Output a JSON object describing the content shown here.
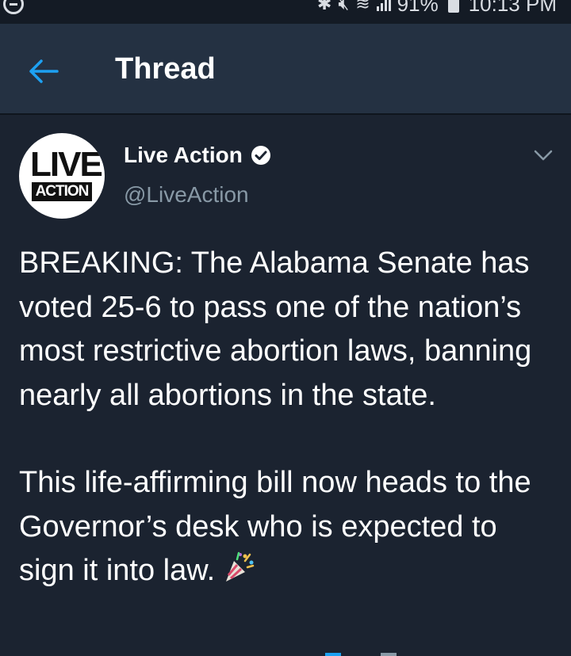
{
  "status_bar": {
    "battery": "91%",
    "time": "10:13 PM",
    "icons": [
      "minus-circle-icon",
      "bluetooth-icon",
      "mute-icon",
      "wifi-icon",
      "signal-icon",
      "battery-icon"
    ]
  },
  "header": {
    "title": "Thread",
    "back_icon": "back-arrow-icon",
    "accent_color": "#1da1f2"
  },
  "tweet": {
    "avatar": {
      "line1": "LIVE",
      "line2": "ACTION"
    },
    "author_name": "Live Action",
    "verified": true,
    "handle": "@LiveAction",
    "paragraph1": "BREAKING: The Alabama Senate has voted 25-6 to pass one of the nation’s most restrictive abortion laws, banning nearly all abortions in the state.",
    "paragraph2": "This life-affirming bill now heads to the Governor’s desk who is expected to sign it into law.",
    "emoji": "party-popper-icon"
  },
  "colors": {
    "background": "#1b2330",
    "header_bg": "#243142",
    "secondary_text": "#8899a6"
  }
}
